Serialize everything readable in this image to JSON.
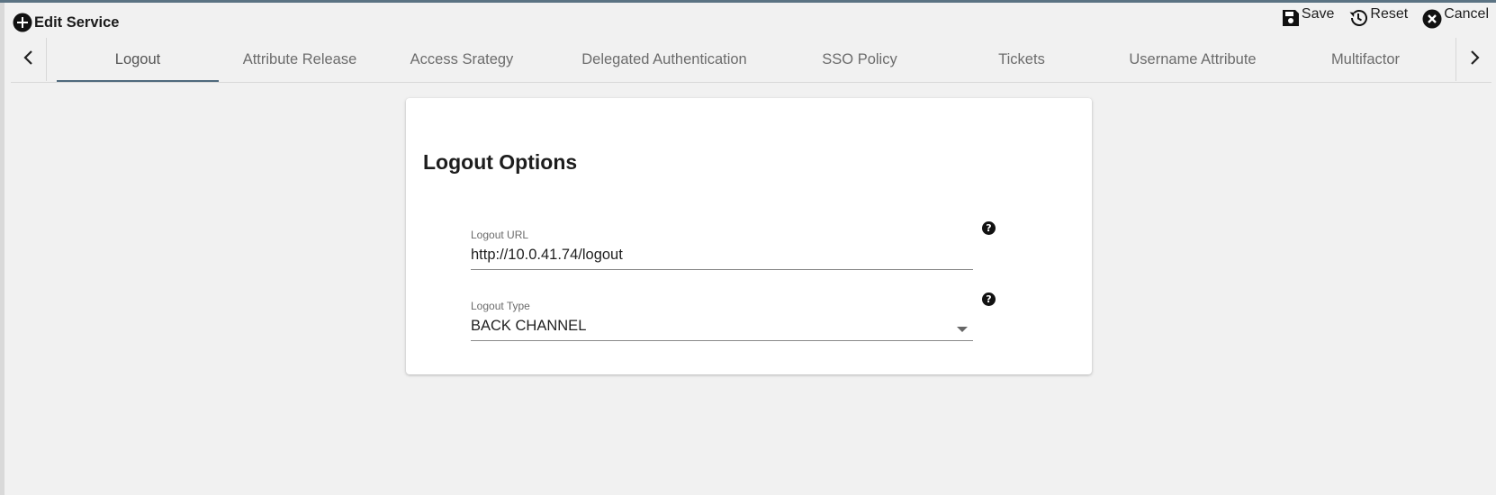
{
  "header": {
    "title": "Edit Service",
    "title_icon": "plus-circle-icon",
    "actions": [
      {
        "label": "Save",
        "icon": "save-icon"
      },
      {
        "label": "Reset",
        "icon": "history-icon"
      },
      {
        "label": "Cancel",
        "icon": "close-circle-icon"
      }
    ]
  },
  "tabs": {
    "active": "Logout",
    "items": [
      {
        "label": "Logout"
      },
      {
        "label": "Attribute Release"
      },
      {
        "label": "Access Srategy"
      },
      {
        "label": "Delegated Authentication"
      },
      {
        "label": "SSO Policy"
      },
      {
        "label": "Tickets"
      },
      {
        "label": "Username Attribute"
      },
      {
        "label": "Multifactor"
      }
    ],
    "prev_icon": "chevron-left-icon",
    "next_icon": "chevron-right-icon"
  },
  "card": {
    "title": "Logout Options",
    "fields": {
      "logout_url": {
        "label": "Logout URL",
        "value": "http://10.0.41.74/logout"
      },
      "logout_type": {
        "label": "Logout Type",
        "value": "BACK CHANNEL"
      }
    }
  },
  "help_glyph": "?",
  "colors": {
    "accent": "#4f6a7d",
    "background": "#f1f1f1",
    "card": "#ffffff",
    "top_border": "#5b7383"
  }
}
